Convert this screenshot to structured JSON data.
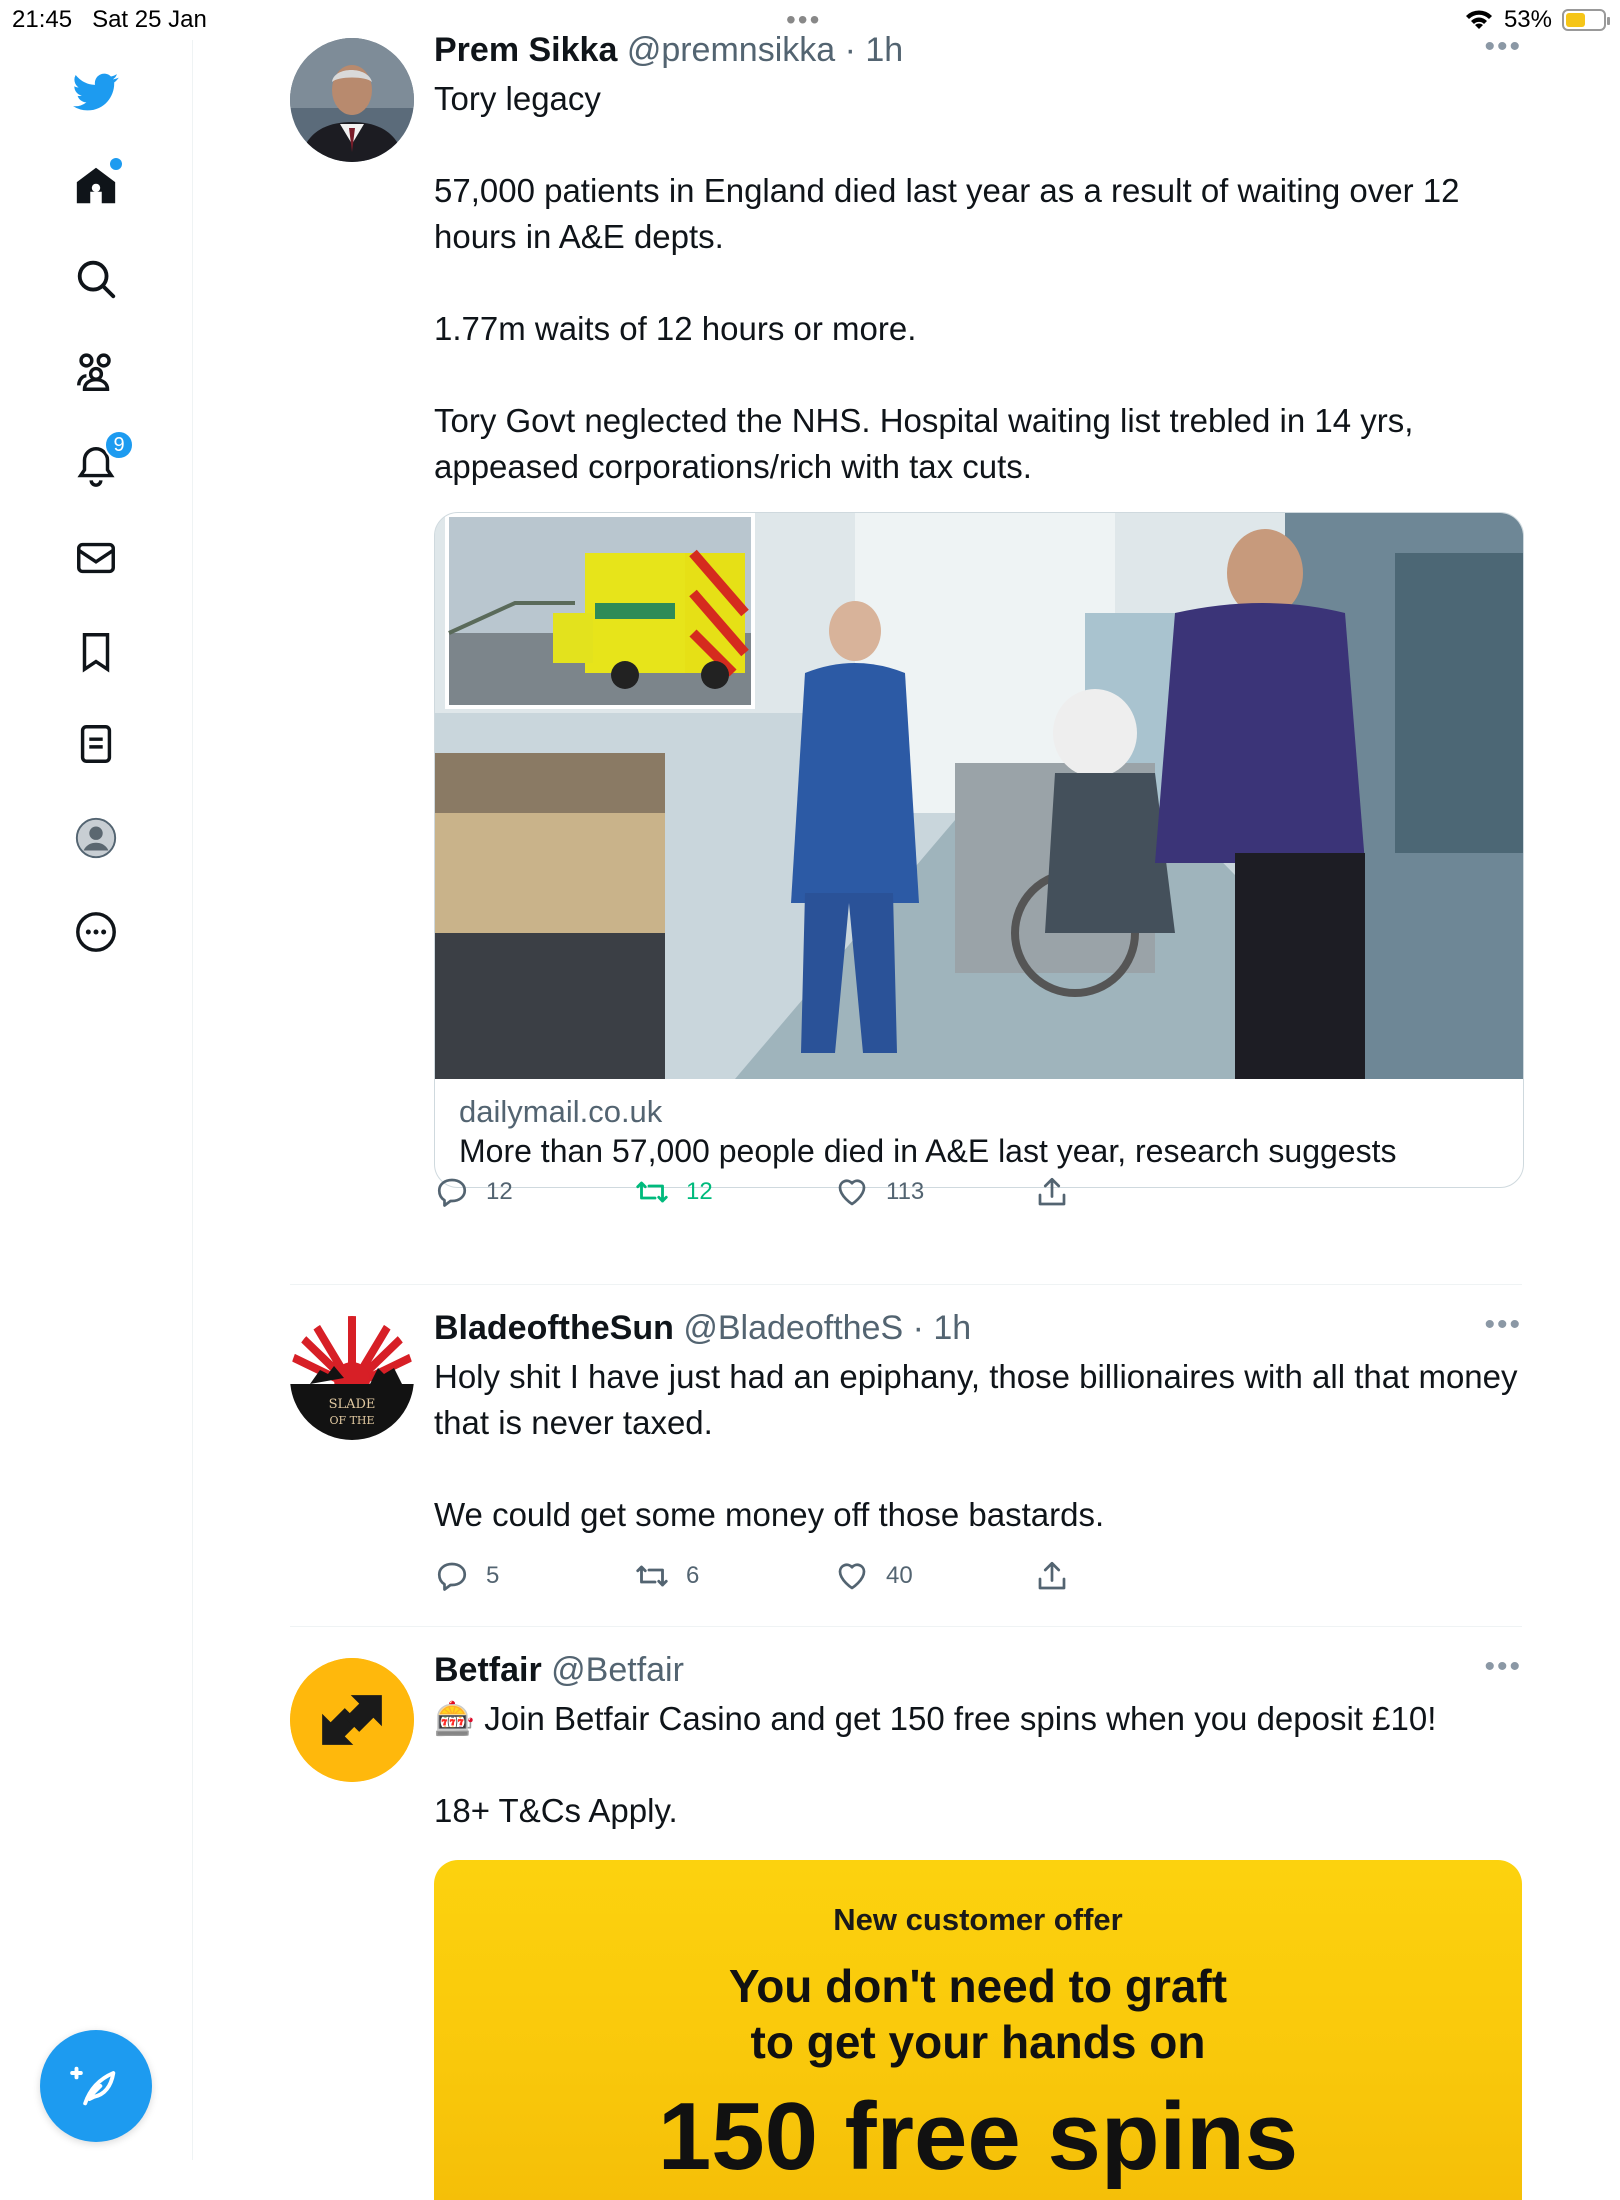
{
  "status_bar": {
    "time": "21:45",
    "date": "Sat 25 Jan",
    "battery": "53%",
    "battery_level": 0.53
  },
  "sidebar": {
    "items": [
      {
        "name": "twitter-logo-icon"
      },
      {
        "name": "home-icon",
        "has_dot": true
      },
      {
        "name": "search-icon"
      },
      {
        "name": "communities-icon"
      },
      {
        "name": "notifications-icon",
        "badge": "9"
      },
      {
        "name": "messages-icon"
      },
      {
        "name": "bookmarks-icon"
      },
      {
        "name": "lists-icon"
      },
      {
        "name": "profile-icon"
      },
      {
        "name": "more-icon"
      }
    ],
    "compose": "compose-icon"
  },
  "tweets": [
    {
      "name": "Prem Sikka",
      "handle": "@premnsikka",
      "time": "· 1h",
      "paragraphs": [
        "Tory legacy",
        "57,000 patients in England died last year as a result of waiting over 12 hours in A&E depts.",
        "1.77m waits of 12 hours or more.",
        "Tory Govt neglected the NHS. Hospital waiting list trebled in 14 yrs, appeased corporations/rich with tax cuts."
      ],
      "card": {
        "domain": "dailymail.co.uk",
        "headline": "More than 57,000 people died in A&E last year, research suggests"
      },
      "replies": "12",
      "retweets": "12",
      "likes": "113"
    },
    {
      "name": "BladeoftheSun",
      "handle": "@BladeoftheS",
      "time": "· 1h",
      "paragraphs": [
        "Holy shit I have just had an epiphany, those billionaires with all that money that is never taxed.",
        "We could get some money off those bastards."
      ],
      "replies": "5",
      "retweets": "6",
      "likes": "40"
    },
    {
      "name": "Betfair",
      "handle": "@Betfair",
      "paragraphs": [
        "🎰 Join Betfair Casino and get 150 free spins when you deposit £10!",
        "18+ T&Cs Apply."
      ],
      "ad": {
        "kicker": "New customer offer",
        "line1": "You don't need to graft",
        "line2": "to get your hands on",
        "line3": "150 free spins"
      }
    }
  ],
  "colors": {
    "accent": "#1d9bf0",
    "retweet_green": "#00ba7c",
    "muted": "#536471",
    "ad_yellow": "#fcd20e"
  }
}
